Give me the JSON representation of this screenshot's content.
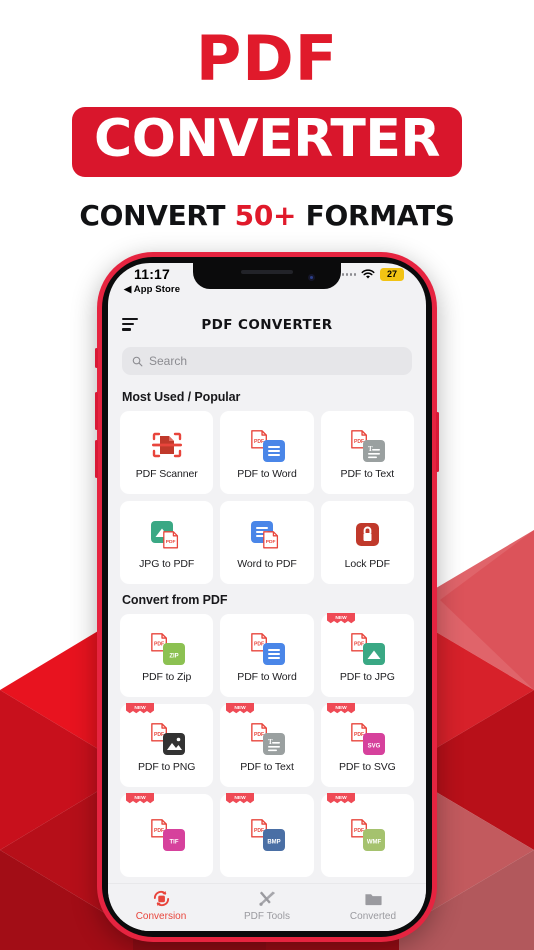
{
  "promo": {
    "line1": "PDF",
    "line2": "CONVERTER",
    "sub_before": "CONVERT ",
    "sub_highlight": "50+",
    "sub_after": " FORMATS",
    "band_color": "#d9162c",
    "accent_color": "#e01a2b"
  },
  "phone": {
    "frame_color": "#e62440",
    "statusbar": {
      "time": "11:17",
      "back_label": "◀ App Store",
      "battery": "27",
      "battery_color": "#f2c314",
      "wifi_icon": "wifi-icon",
      "signal_icon": "signal-dots-icon"
    },
    "navbar": {
      "menu_icon": "hamburger-menu-icon",
      "title": "PDF CONVERTER"
    },
    "search": {
      "placeholder": "Search",
      "icon": "search-icon",
      "value": ""
    },
    "sections": [
      {
        "title": "Most Used / Popular",
        "items": [
          {
            "label": "PDF Scanner",
            "icon": "pdf-scanner-icon",
            "badge": "",
            "chip": "",
            "chip_color": "#c0392b"
          },
          {
            "label": "PDF to Word",
            "icon": "pdf-to-word-icon",
            "badge": "",
            "chip": "",
            "chip_color": "#4a86e8"
          },
          {
            "label": "PDF to Text",
            "icon": "pdf-to-text-icon",
            "badge": "",
            "chip": "",
            "chip_color": "#9aa0a0"
          }
        ]
      },
      {
        "title": "",
        "items": [
          {
            "label": "JPG to PDF",
            "icon": "jpg-to-pdf-icon",
            "badge": "",
            "chip": "",
            "chip_color": "#3aa884"
          },
          {
            "label": "Word to PDF",
            "icon": "word-to-pdf-icon",
            "badge": "",
            "chip": "",
            "chip_color": "#4a86e8"
          },
          {
            "label": "Lock PDF",
            "icon": "lock-pdf-icon",
            "badge": "",
            "chip": "",
            "chip_color": "#c0392b"
          }
        ]
      },
      {
        "title": "Convert from PDF",
        "items": [
          {
            "label": "PDF to Zip",
            "icon": "pdf-to-zip-icon",
            "badge": "",
            "chip": "ZIP",
            "chip_color": "#8cc152"
          },
          {
            "label": "PDF to Word",
            "icon": "pdf-to-word-icon",
            "badge": "",
            "chip": "",
            "chip_color": "#4a86e8"
          },
          {
            "label": "PDF to JPG",
            "icon": "pdf-to-jpg-icon",
            "badge": "NEW",
            "chip": "",
            "chip_color": "#3aa884"
          },
          {
            "label": "PDF to PNG",
            "icon": "pdf-to-png-icon",
            "badge": "NEW",
            "chip": "",
            "chip_color": "#333333"
          },
          {
            "label": "PDF to Text",
            "icon": "pdf-to-text-icon",
            "badge": "NEW",
            "chip": "",
            "chip_color": "#9aa0a0"
          },
          {
            "label": "PDF to SVG",
            "icon": "pdf-to-svg-icon",
            "badge": "NEW",
            "chip": "SVG",
            "chip_color": "#d6419c"
          },
          {
            "label": "",
            "icon": "pdf-to-tif-icon",
            "badge": "NEW",
            "chip": "TIF",
            "chip_color": "#d6419c"
          },
          {
            "label": "",
            "icon": "pdf-to-bmp-icon",
            "badge": "NEW",
            "chip": "BMP",
            "chip_color": "#4a6fa5"
          },
          {
            "label": "",
            "icon": "pdf-to-wmf-icon",
            "badge": "NEW",
            "chip": "WMF",
            "chip_color": "#a5c26e"
          }
        ]
      }
    ],
    "tabs": [
      {
        "label": "Conversion",
        "icon": "conversion-icon",
        "active": true
      },
      {
        "label": "PDF Tools",
        "icon": "tools-icon",
        "active": false
      },
      {
        "label": "Converted",
        "icon": "folder-icon",
        "active": false
      }
    ],
    "tab_active_color": "#e8453c",
    "tab_inactive_color": "#9a9a9f"
  }
}
